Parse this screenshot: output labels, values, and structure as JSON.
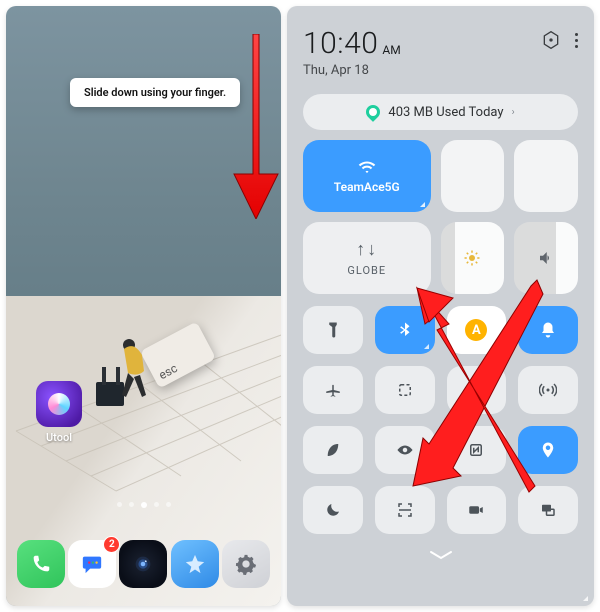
{
  "left_pane": {
    "tooltip_text": "Slide down using your finger.",
    "esc_label": "esc",
    "widget_label": "Utool",
    "page_indicator": {
      "count": 5,
      "active_index": 2
    },
    "dock": {
      "badge_messages": "2",
      "apps": [
        {
          "name": "phone"
        },
        {
          "name": "messages"
        },
        {
          "name": "camera"
        },
        {
          "name": "gallery"
        },
        {
          "name": "settings"
        }
      ]
    }
  },
  "right_pane": {
    "time": "10:40",
    "ampm": "AM",
    "date": "Thu, Apr 18",
    "data_usage_text": "403 MB Used Today",
    "wifi": {
      "active": true,
      "label": "TeamAce5G"
    },
    "mobile_data": {
      "label": "GLOBE"
    },
    "brightness_pct": 22,
    "volume_pct": 65,
    "toggles": [
      {
        "name": "flashlight",
        "state": "off"
      },
      {
        "name": "bluetooth",
        "state": "on-blue"
      },
      {
        "name": "auto-rotate",
        "state": "on-white-amber"
      },
      {
        "name": "notifications",
        "state": "on-blue"
      },
      {
        "name": "airplane",
        "state": "off"
      },
      {
        "name": "screenshot",
        "state": "off"
      },
      {
        "name": "vibrate",
        "state": "off"
      },
      {
        "name": "hotspot",
        "state": "off"
      },
      {
        "name": "power-saver",
        "state": "off"
      },
      {
        "name": "eye-comfort",
        "state": "off"
      },
      {
        "name": "nfc",
        "state": "off"
      },
      {
        "name": "location",
        "state": "on-blue"
      },
      {
        "name": "do-not-disturb",
        "state": "off"
      },
      {
        "name": "scan",
        "state": "off"
      },
      {
        "name": "screen-record",
        "state": "off"
      },
      {
        "name": "cast",
        "state": "off"
      }
    ]
  },
  "colors": {
    "accent_blue": "#3b9cff",
    "accent_amber": "#ffb300",
    "arrow_red": "#ff1e1e"
  }
}
